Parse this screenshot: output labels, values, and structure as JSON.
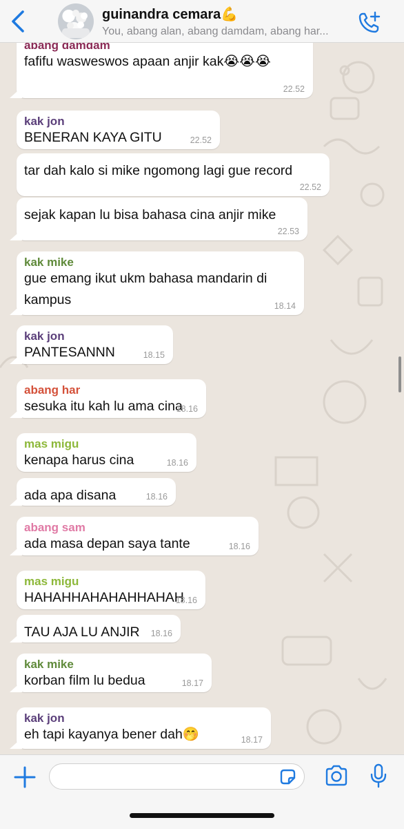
{
  "header": {
    "title": "guinandra cemara💪",
    "subtitle": "You, abang alan, abang damdam, abang har..."
  },
  "colors": {
    "accent": "#1f7ae0",
    "chat_background": "#ebe5de",
    "bubble": "#ffffff",
    "sender_abang_damdam": "#8a2a55",
    "sender_kak_jon": "#5b3f7a",
    "sender_kak_mike": "#5f8a3a",
    "sender_abang_har": "#d4513a",
    "sender_mas_migu": "#8db83a",
    "sender_abang_sam": "#e07aa5"
  },
  "messages": [
    {
      "sender": "abang damdam",
      "text": "fafifu wasweswos apaan anjir kak😭😭😭",
      "time": "22.52"
    },
    {
      "sender": "kak jon",
      "text": "BENERAN KAYA GITU",
      "time": "22.52"
    },
    {
      "text": "tar dah kalo si mike ngomong lagi gue record",
      "time": "22.52"
    },
    {
      "text": "sejak kapan lu bisa bahasa cina anjir mike",
      "time": "22.53"
    },
    {
      "sender": "kak mike",
      "text": "gue emang ikut ukm bahasa mandarin di",
      "text2": "kampus",
      "time": "18.14"
    },
    {
      "sender": "kak jon",
      "text": "PANTESANNN",
      "time": "18.15"
    },
    {
      "sender": "abang har",
      "text": "sesuka itu kah lu ama cina",
      "time": "18.16"
    },
    {
      "sender": "mas migu",
      "text": "kenapa harus cina",
      "time": "18.16"
    },
    {
      "text": "ada apa disana",
      "time": "18.16"
    },
    {
      "sender": "abang sam",
      "text": "ada masa depan saya tante",
      "time": "18.16"
    },
    {
      "sender": "mas migu",
      "text": "HAHAHHAHAHAHHAHAH",
      "time": "18.16"
    },
    {
      "text": "TAU AJA LU ANJIR",
      "time": "18.16"
    },
    {
      "sender": "kak mike",
      "text": "korban film lu bedua",
      "time": "18.17"
    },
    {
      "sender": "kak jon",
      "text": "eh tapi kayanya bener dah🤭",
      "time": "18.17"
    }
  ],
  "composer": {
    "value": "",
    "placeholder": ""
  },
  "icons": {
    "back": "chevron-left-icon",
    "call": "add-call-icon",
    "plus": "plus-icon",
    "sticker": "sticker-icon",
    "camera": "camera-icon",
    "mic": "microphone-icon"
  }
}
